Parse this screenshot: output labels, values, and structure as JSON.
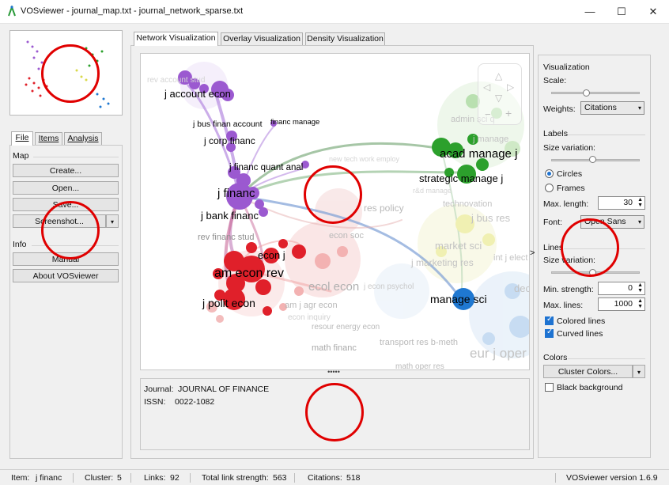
{
  "window": {
    "title": "VOSviewer - journal_map.txt - journal_network_sparse.txt",
    "controls": {
      "minimize": "—",
      "maximize": "☐",
      "close": "✕"
    }
  },
  "left_panel": {
    "tabs": [
      {
        "label": "File",
        "active": true
      },
      {
        "label": "Items",
        "active": false
      },
      {
        "label": "Analysis",
        "active": false
      }
    ],
    "map_section": "Map",
    "buttons": {
      "create": "Create...",
      "open": "Open...",
      "save": "Save...",
      "screenshot": "Screenshot..."
    },
    "info_section": "Info",
    "info_buttons": {
      "manual": "Manual",
      "about": "About VOSviewer"
    }
  },
  "viz_tabs": [
    {
      "label": "Network Visualization",
      "active": true
    },
    {
      "label": "Overlay Visualization",
      "active": false
    },
    {
      "label": "Density Visualization",
      "active": false
    }
  ],
  "network": {
    "labels": [
      {
        "text": "j account econ",
        "color": "#000000"
      },
      {
        "text": "j bus finan account",
        "color": "#000000"
      },
      {
        "text": "financ manage",
        "color": "#000000"
      },
      {
        "text": "j corp financ",
        "color": "#000000"
      },
      {
        "text": "j financ quant anal",
        "color": "#000000"
      },
      {
        "text": "j financ",
        "color": "#000000"
      },
      {
        "text": "j bank financ",
        "color": "#000000"
      },
      {
        "text": "rev financ stud",
        "color": "#8f8f8f"
      },
      {
        "text": "econ j",
        "color": "#000000"
      },
      {
        "text": "am econ rev",
        "color": "#000000"
      },
      {
        "text": "j polit econ",
        "color": "#000000"
      },
      {
        "text": "ecol econ",
        "color": "#b0b0b0"
      },
      {
        "text": "econ soc",
        "color": "#b9b9b9"
      },
      {
        "text": "am j agr econ",
        "color": "#b9b9b9"
      },
      {
        "text": "resour energy econ",
        "color": "#b9b9b9"
      },
      {
        "text": "math financ",
        "color": "#a9a9a9"
      },
      {
        "text": "res policy",
        "color": "#b9b9b9"
      },
      {
        "text": "acad manage j",
        "color": "#000000"
      },
      {
        "text": "strategic manage j",
        "color": "#000000"
      },
      {
        "text": "admin sci q",
        "color": "#c3c3c3"
      },
      {
        "text": "j manage",
        "color": "#c3c3c3"
      },
      {
        "text": "technovation",
        "color": "#c3c3c3"
      },
      {
        "text": "j bus res",
        "color": "#c3c3c3"
      },
      {
        "text": "market sci",
        "color": "#c3c3c3"
      },
      {
        "text": "j marketing res",
        "color": "#c3c3c3"
      },
      {
        "text": "int j elect",
        "color": "#c3c3c3"
      },
      {
        "text": "manage sci",
        "color": "#000000"
      },
      {
        "text": "dec",
        "color": "#c3c3c3"
      },
      {
        "text": "transport res b-meth",
        "color": "#b9b9b9"
      },
      {
        "text": "eur j oper",
        "color": "#c3c3c3"
      },
      {
        "text": "math oper res",
        "color": "#b9b9b9"
      },
      {
        "text": "new tech work employ",
        "color": "#d4d4d4"
      },
      {
        "text": "rev account stud",
        "color": "#d4d4d4"
      },
      {
        "text": "r&d manage",
        "color": "#d4d4d4"
      },
      {
        "text": "j econ psychol",
        "color": "#c9c9c9"
      },
      {
        "text": "econ inquiry",
        "color": "#d0d0d0"
      }
    ]
  },
  "item_info": {
    "journal_label": "Journal:",
    "journal_value": "JOURNAL OF FINANCE",
    "issn_label": "ISSN:",
    "issn_value": "0022-1082"
  },
  "right_panel": {
    "visualization_title": "Visualization",
    "scale_label": "Scale:",
    "weights_label": "Weights:",
    "weights_value": "Citations",
    "labels_title": "Labels",
    "size_variation_label": "Size variation:",
    "circles_label": "Circles",
    "frames_label": "Frames",
    "max_length_label": "Max. length:",
    "max_length_value": "30",
    "font_label": "Font:",
    "font_value": "Open Sans",
    "lines_title": "Lines",
    "lines_size_variation_label": "Size variation:",
    "min_strength_label": "Min. strength:",
    "min_strength_value": "0",
    "max_lines_label": "Max. lines:",
    "max_lines_value": "1000",
    "colored_lines_label": "Colored lines",
    "curved_lines_label": "Curved lines",
    "colors_title": "Colors",
    "cluster_colors_button": "Cluster Colors...",
    "black_background_label": "Black background",
    "collapse_arrow": ">"
  },
  "statusbar": {
    "item_label": "Item:",
    "item_value": "j financ",
    "cluster_label": "Cluster:",
    "cluster_value": "5",
    "links_label": "Links:",
    "links_value": "92",
    "tls_label": "Total link strength:",
    "tls_value": "563",
    "citations_label": "Citations:",
    "citations_value": "518",
    "version": "VOSviewer version 1.6.9"
  },
  "colors": {
    "purple": "#9b59d0",
    "red": "#e0202a",
    "green": "#2ca02c",
    "blue": "#1f78d1",
    "yellow": "#d9d94a",
    "accent": "#1e73d1",
    "annotation": "#e00000"
  }
}
